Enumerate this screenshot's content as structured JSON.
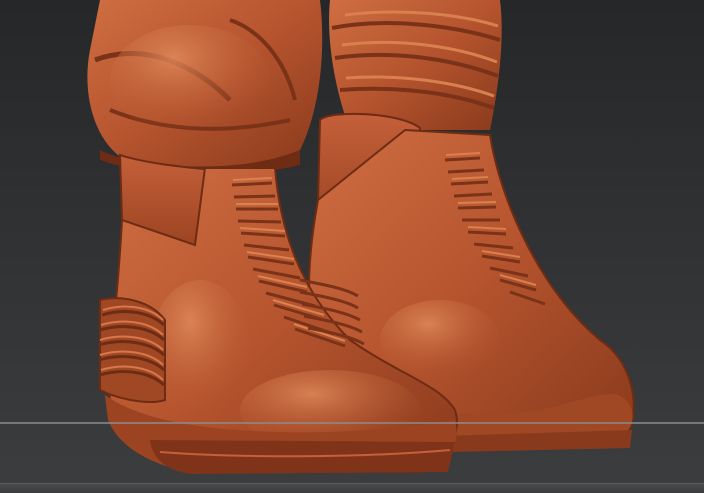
{
  "viewport": {
    "background_top": "#262728",
    "background_bottom": "#3c3d3f",
    "clay_color": "#b5542e",
    "clay_highlight": "#d8774b",
    "clay_shadow": "#6e2c14",
    "floor_line_color": "#8b8c8e",
    "subject": "sculpted-boots-model"
  }
}
